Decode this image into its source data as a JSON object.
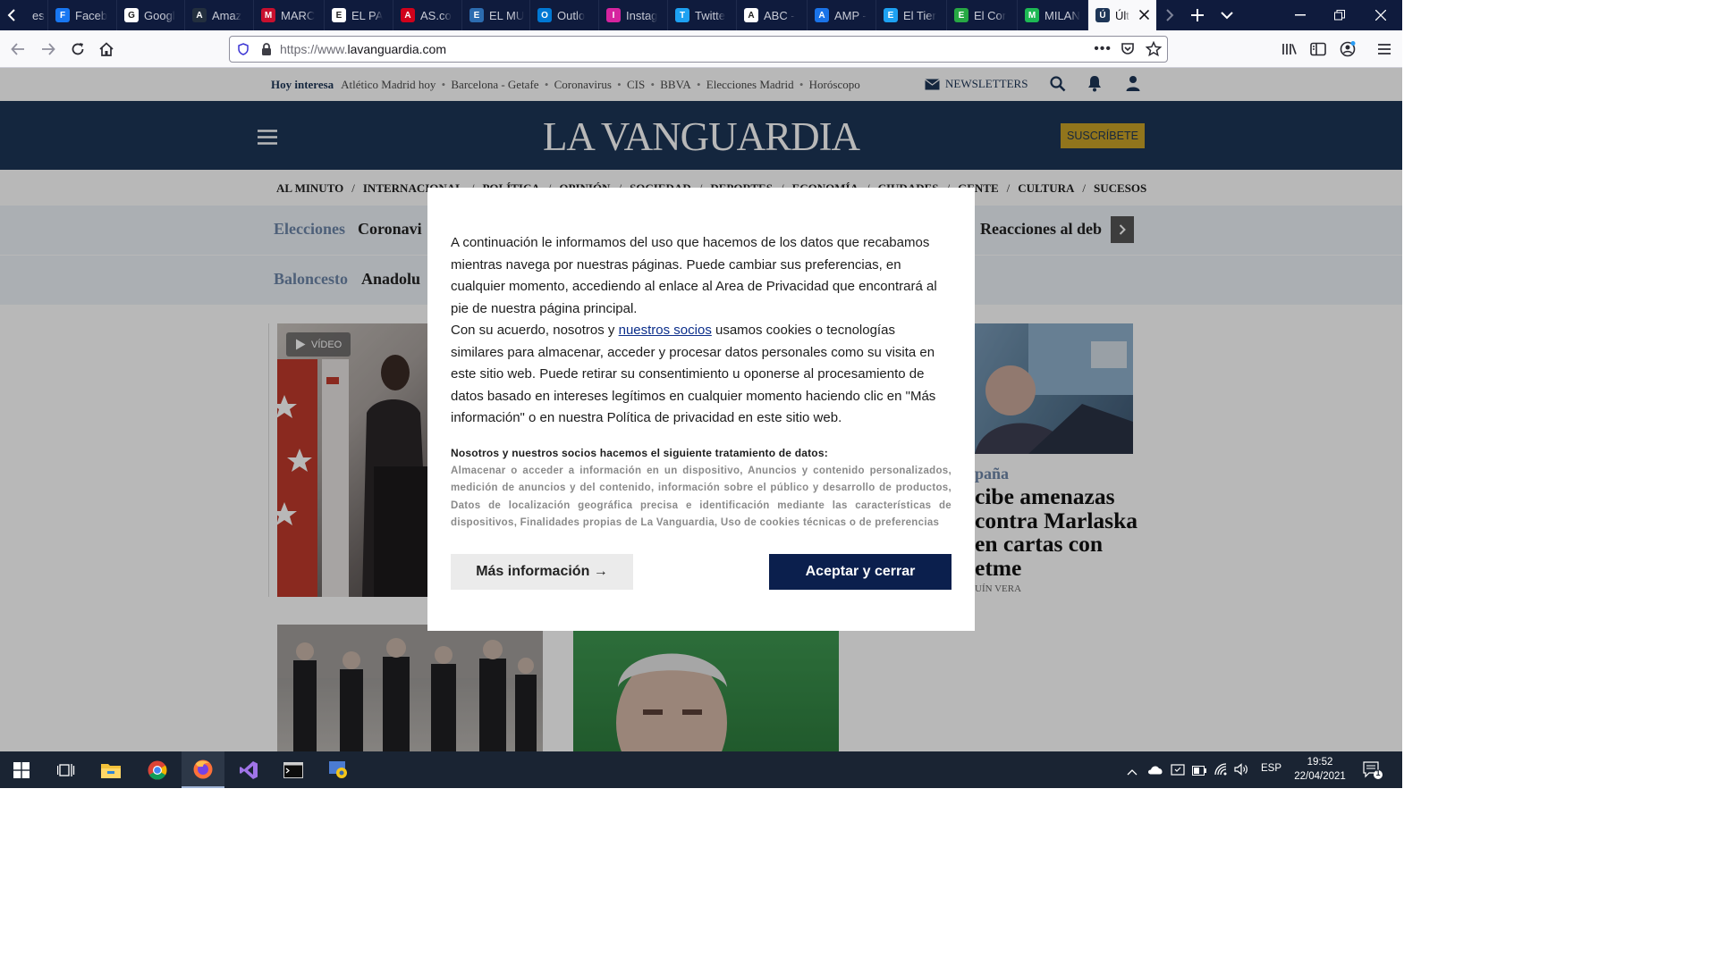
{
  "browser": {
    "tabs": [
      {
        "label": "es",
        "icon": "tab-generic-icon",
        "color": "#5b6b8c"
      },
      {
        "label": "Faceb",
        "icon": "facebook-icon",
        "color": "#1877f2"
      },
      {
        "label": "Googl",
        "icon": "google-icon",
        "color": "#ffffff"
      },
      {
        "label": "Amaz",
        "icon": "amazon-icon",
        "color": "#232f3e"
      },
      {
        "label": "MARC",
        "icon": "marca-icon",
        "color": "#c8102e"
      },
      {
        "label": "EL PA",
        "icon": "elpais-icon",
        "color": "#ffffff"
      },
      {
        "label": "AS.co",
        "icon": "as-icon",
        "color": "#d0021b"
      },
      {
        "label": "EL MU",
        "icon": "globe-icon",
        "color": "#2c6cb0"
      },
      {
        "label": "Outlo",
        "icon": "outlook-icon",
        "color": "#0078d4"
      },
      {
        "label": "Instag",
        "icon": "instagram-icon",
        "color": "#d6249f"
      },
      {
        "label": "Twitte",
        "icon": "twitter-icon",
        "color": "#1da1f2"
      },
      {
        "label": "ABC -",
        "icon": "abc-icon",
        "color": "#ffffff"
      },
      {
        "label": "AMP -",
        "icon": "amp-icon",
        "color": "#1a73e8"
      },
      {
        "label": "El Tier",
        "icon": "eltiempo-icon",
        "color": "#1da1f2"
      },
      {
        "label": "El Cor",
        "icon": "elcorreo-icon",
        "color": "#27a844"
      },
      {
        "label": "MILAN",
        "icon": "milanuncios-icon",
        "color": "#1db954"
      },
      {
        "label": "Últ",
        "icon": "vanguardia-icon",
        "color": "#1d3557"
      }
    ],
    "url_prefix": "https://www.",
    "url_domain": "lavanguardia.com"
  },
  "site": {
    "hoy_label": "Hoy interesa",
    "hoy_items": [
      "Atlético Madrid hoy",
      "Barcelona - Getafe",
      "Coronavirus",
      "CIS",
      "BBVA",
      "Elecciones Madrid",
      "Horóscopo"
    ],
    "newsletters": "NEWSLETTERS",
    "logo": "LA VANGUARDIA",
    "subscribe": "SUSCRÍBETE",
    "sections": [
      "AL MINUTO",
      "INTERNACIONAL",
      "POLÍTICA",
      "OPINIÓN",
      "SOCIEDAD",
      "DEPORTES",
      "ECONOMÍA",
      "CIUDADES",
      "GENTE",
      "CULTURA",
      "SUCESOS"
    ],
    "strip1": {
      "label": "Elecciones",
      "text": "Coronavi",
      "right": "Reacciones al deb"
    },
    "strip2": {
      "label": "Baloncesto",
      "text": "Anadolu"
    },
    "video_badge": "VÍDEO",
    "side_kicker": "paña",
    "side_headline": "cibe amenazas contra Marlaska en cartas con etme",
    "side_author": "UÍN VERA",
    "accent": "#6d86a8"
  },
  "modal": {
    "paragraph1": "A continuación le informamos del uso que hacemos de los datos que recabamos mientras navega por nuestras páginas. Puede cambiar sus preferencias, en cualquier momento, accediendo al enlace al Area de Privacidad que encontrará al pie de nuestra página principal.",
    "p2_before": "Con su acuerdo, nosotros y ",
    "p2_link": "nuestros socios",
    "p2_after": " usamos cookies o tecnologías similares para almacenar, acceder y procesar datos personales como su visita en este sitio web. Puede retirar su consentimiento u oponerse al procesamiento de datos basado en intereses legítimos en cualquier momento haciendo clic en \"Más información\" o en nuestra Política de privacidad en este sitio web.",
    "processing_title": "Nosotros y nuestros socios hacemos el siguiente tratamiento de datos:",
    "processing_list": "Almacenar o acceder a información en un dispositivo, Anuncios y contenido personalizados, medición de anuncios y del contenido, información sobre el público y desarrollo de productos, Datos de localización geográfica precisa e identificación mediante las características de dispositivos, Finalidades propias de La Vanguardia, Uso de cookies técnicas o de preferencias",
    "more_info": "Más información →",
    "accept": "Aceptar y cerrar",
    "accept_color": "#0b1f4d"
  },
  "taskbar": {
    "language": "ESP",
    "time": "19:52",
    "date": "22/04/2021",
    "notifications": "1"
  }
}
